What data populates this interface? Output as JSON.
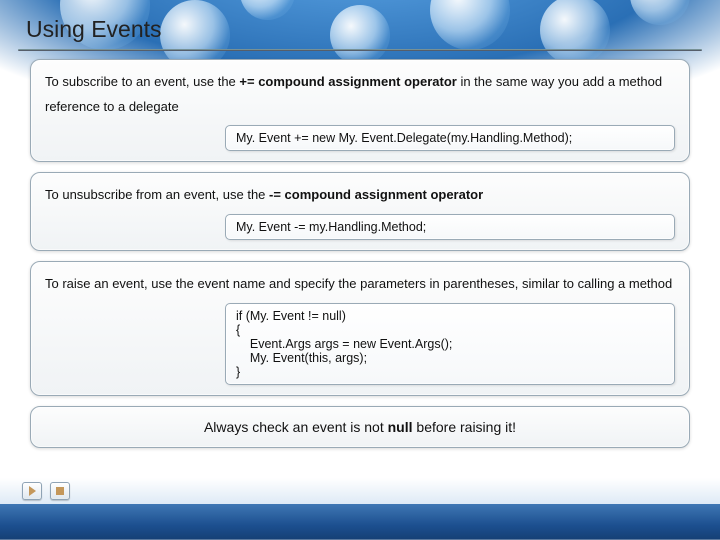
{
  "title": "Using Events",
  "sections": {
    "subscribe": {
      "text_pre": "To subscribe to an event, use the ",
      "operator": "+= compound assignment operator",
      "text_post": " in the same way you add a method reference to a delegate",
      "code": "My. Event += new My. Event.Delegate(my.Handling.Method);"
    },
    "unsubscribe": {
      "text_pre": "To unsubscribe from an event, use the ",
      "operator": "-= compound assignment operator",
      "code": "My. Event -= my.Handling.Method;"
    },
    "raise": {
      "text": "To raise an event, use the event name and specify the parameters in parentheses, similar to calling a method",
      "code": "if (My. Event != null)\n{\n    Event.Args args = new Event.Args();\n    My. Event(this, args);\n}"
    }
  },
  "note": {
    "prefix": "Always check an event is not ",
    "bold": "null",
    "suffix": " before raising it!"
  },
  "nav": {
    "next": "next-slide",
    "stop": "stop"
  }
}
